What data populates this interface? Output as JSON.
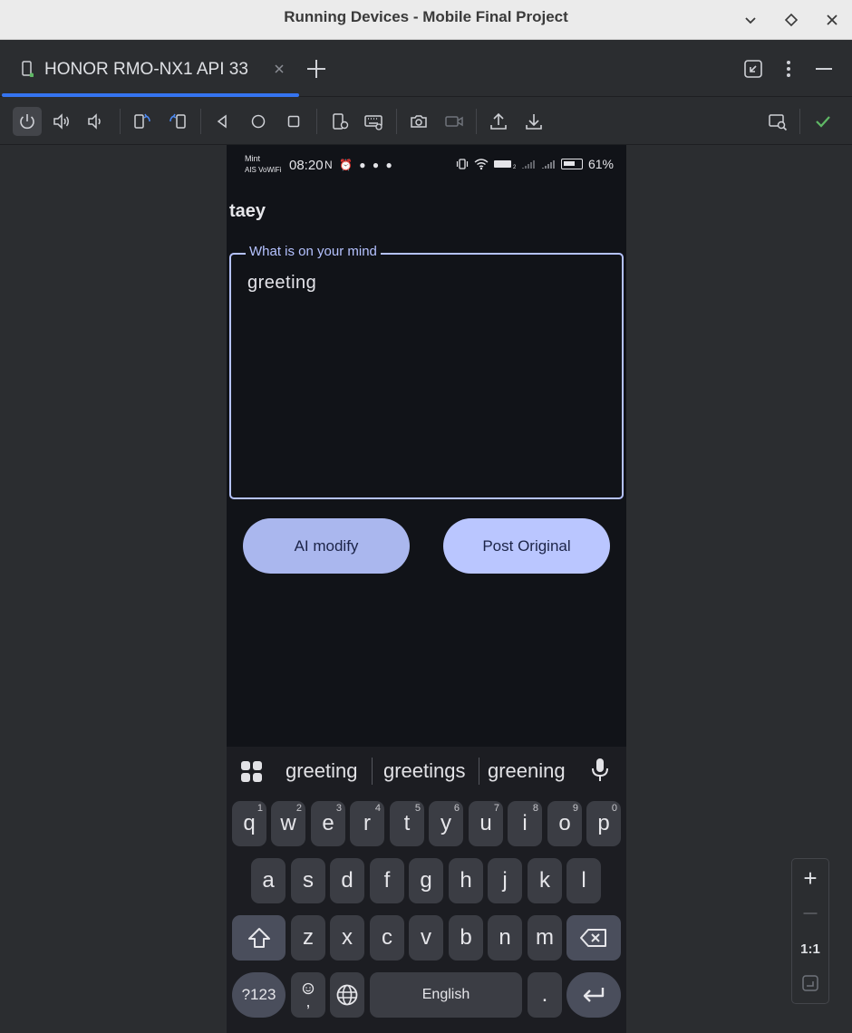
{
  "window": {
    "title": "Running Devices - Mobile Final Project"
  },
  "tabs": [
    {
      "label": "HONOR RMO-NX1 API 33",
      "active": true
    }
  ],
  "device": {
    "status": {
      "carrier_top": "Mint",
      "carrier_bottom": "AIS VoWiFi",
      "time": "08:20",
      "notif_icons": "N ⏰ ● ● ●",
      "battery": "61%"
    },
    "username": "taey",
    "post_field": {
      "label": "What is on your mind",
      "value": "greeting"
    },
    "buttons": {
      "ai_modify": "AI modify",
      "post_original": "Post Original"
    }
  },
  "keyboard": {
    "suggestions": [
      "greeting",
      "greetings",
      "greening"
    ],
    "row1": [
      {
        "key": "q",
        "sup": "1"
      },
      {
        "key": "w",
        "sup": "2"
      },
      {
        "key": "e",
        "sup": "3"
      },
      {
        "key": "r",
        "sup": "4"
      },
      {
        "key": "t",
        "sup": "5"
      },
      {
        "key": "y",
        "sup": "6"
      },
      {
        "key": "u",
        "sup": "7"
      },
      {
        "key": "i",
        "sup": "8"
      },
      {
        "key": "o",
        "sup": "9"
      },
      {
        "key": "p",
        "sup": "0"
      }
    ],
    "row2": [
      "a",
      "s",
      "d",
      "f",
      "g",
      "h",
      "j",
      "k",
      "l"
    ],
    "row3": [
      "z",
      "x",
      "c",
      "v",
      "b",
      "n",
      "m"
    ],
    "symbols_key": "?123",
    "comma_key": ",",
    "space_key": "English",
    "period_key": "."
  },
  "zoom": {
    "plus": "+",
    "minus": "—",
    "actual_size": "1:1"
  },
  "colors": {
    "accent": "#3574f0",
    "field_border": "#b5c2ff",
    "ai_button": "#aab7ee",
    "post_button": "#bac6ff",
    "check": "#5fb865"
  }
}
